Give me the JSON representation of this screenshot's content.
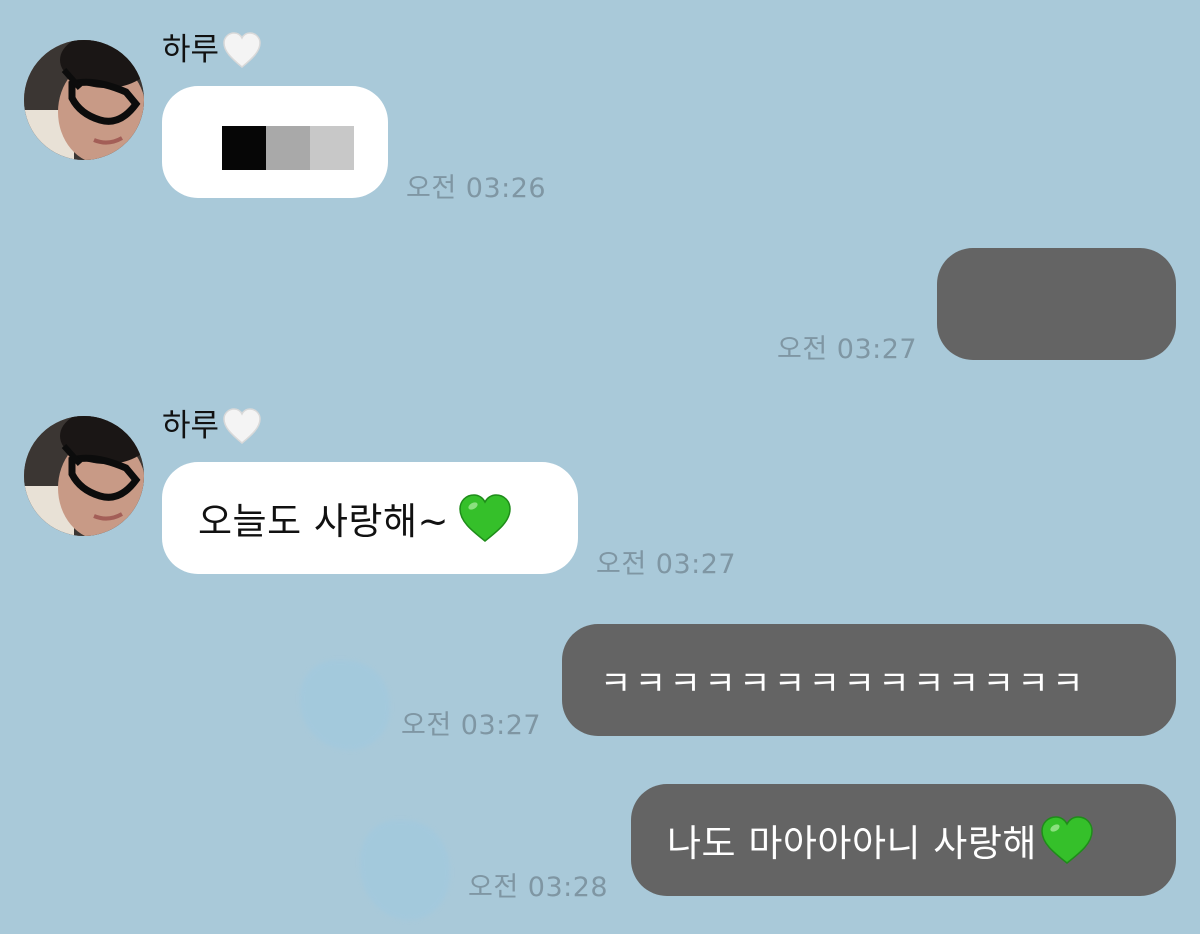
{
  "contact": {
    "name": "하루"
  },
  "messages": [
    {
      "id": "m1",
      "direction": "in",
      "text": "",
      "time": "오전 03:26",
      "censored": true
    },
    {
      "id": "m2",
      "direction": "out",
      "text": "",
      "time": "오전 03:27",
      "censored": true
    },
    {
      "id": "m3",
      "direction": "in",
      "text": "오늘도 사랑해~",
      "time": "오전 03:27",
      "emoji": "green-heart"
    },
    {
      "id": "m4",
      "direction": "out",
      "text": "ㅋㅋㅋㅋㅋㅋㅋㅋㅋㅋㅋㅋㅋㅋ",
      "time": "오전 03:27"
    },
    {
      "id": "m5",
      "direction": "out",
      "text": "나도 마아아아니 사랑해",
      "time": "오전 03:28",
      "emoji": "green-heart"
    }
  ],
  "colors": {
    "background": "#a9c9d9",
    "incoming_bubble": "#ffffff",
    "outgoing_bubble": "#646464",
    "timestamp": "#7f96a3",
    "green_heart": "#35c02a"
  },
  "icons": {
    "name_suffix": "white-heart-icon",
    "emoji": "green-heart-icon"
  }
}
